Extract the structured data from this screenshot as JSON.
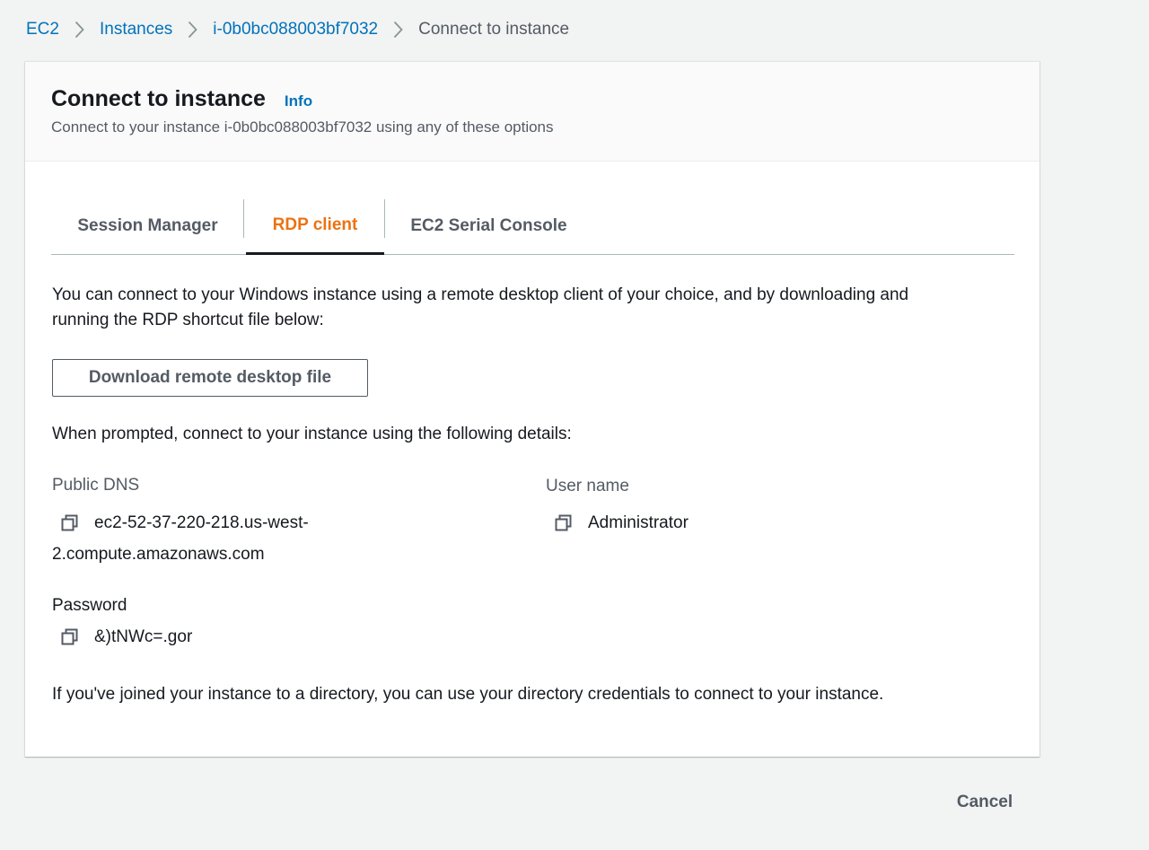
{
  "breadcrumb": {
    "items": [
      {
        "label": "EC2"
      },
      {
        "label": "Instances"
      },
      {
        "label": "i-0b0bc088003bf7032"
      }
    ],
    "current": "Connect to instance"
  },
  "header": {
    "title": "Connect to instance",
    "info_label": "Info",
    "subtitle": "Connect to your instance i-0b0bc088003bf7032 using any of these options"
  },
  "tabs": [
    {
      "label": "Session Manager",
      "active": false
    },
    {
      "label": "RDP client",
      "active": true
    },
    {
      "label": "EC2 Serial Console",
      "active": false
    }
  ],
  "rdp": {
    "intro_line1": "You can connect to your Windows instance using a remote desktop client of your choice, and by downloading and",
    "intro_line2": "running the RDP shortcut file below:",
    "download_label": "Download remote desktop file",
    "prompt_text": "When prompted, connect to your instance using the following details:",
    "public_dns": {
      "label": "Public DNS",
      "value_line1": "ec2-52-37-220-218.us-west-",
      "value_line2": "2.compute.amazonaws.com"
    },
    "user_name": {
      "label": "User name",
      "value": "Administrator"
    },
    "password": {
      "label": "Password",
      "value": "&)tNWc=.gor"
    },
    "directory_note": "If you've joined your instance to a directory, you can use your directory credentials to connect to your instance."
  },
  "footer": {
    "cancel_label": "Cancel"
  },
  "icons": {
    "breadcrumb_separator": "chevron-right-icon",
    "copy": "copy-icon"
  },
  "colors": {
    "link": "#0073bb",
    "active_tab": "#ec7211",
    "text": "#16191f",
    "secondary_text": "#545b64",
    "page_background": "#f2f3f3"
  }
}
